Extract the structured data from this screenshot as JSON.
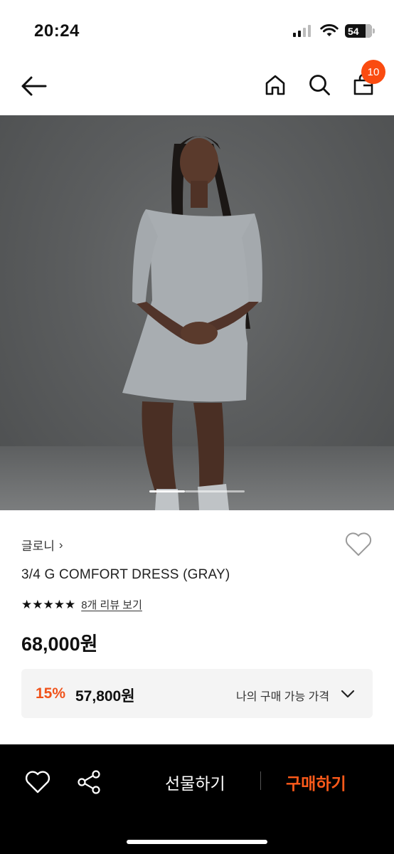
{
  "status": {
    "time": "20:24",
    "battery": "54"
  },
  "nav": {
    "cart_count": "10",
    "icons": [
      "back-arrow-icon",
      "home-icon",
      "search-icon",
      "shopping-bag-icon"
    ]
  },
  "product": {
    "brand": "글로니",
    "brand_chevron": "›",
    "name": "3/4 G COMFORT DRESS (GRAY)",
    "rating_stars": "★★★★★",
    "rating": 5,
    "review_link": "8개 리뷰 보기",
    "price": "68,000원",
    "discount_percent": "15%",
    "discount_price": "57,800원",
    "discount_label": "나의 구매 가능 가격"
  },
  "carousel": {
    "active_index": 0,
    "count": 2
  },
  "bottom_bar": {
    "gift_label": "선물하기",
    "buy_label": "구매하기"
  },
  "colors": {
    "accent": "#fa4b10",
    "discount": "#f0521a",
    "buy": "#ff5a1a",
    "bottom_bg": "#000000"
  }
}
